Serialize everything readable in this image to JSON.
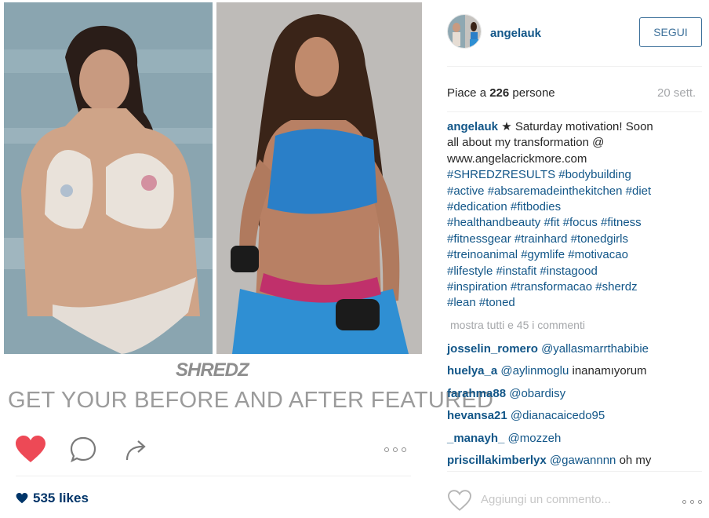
{
  "post": {
    "brand_logo": "SHREDZ",
    "banner": "GET YOUR BEFORE AND AFTER FEATURED",
    "likes": "535 likes"
  },
  "sidebar": {
    "username": "angelauk",
    "follow_label": "SEGUI",
    "likes_prefix": "Piace a",
    "likes_count": "226",
    "likes_suffix": "persone",
    "date": "20 sett.",
    "caption": {
      "user": "angelauk",
      "lines": [
        "★ Saturday motivation! Soon",
        "all about my transformation @",
        "www.angelacrickmore.com",
        "#SHREDZRESULTS #bodybuilding",
        "#active #absaremadeinthekitchen #diet",
        "#dedication #fitbodies",
        "#healthandbeauty #fit #focus #fitness",
        "#fitnessgear #trainhard #tonedgirls",
        "#treinoanimal #gymlife #motivacao",
        "#lifestyle #instafit #instagood",
        "#inspiration #transformacao #sherdz",
        "#lean #toned"
      ]
    },
    "show_all_comments": "mostra tutti e 45 i commenti",
    "comments": [
      {
        "user": "josselin_romero",
        "mention": "@yallasmarrthabibie",
        "text": ""
      },
      {
        "user": "huelya_a",
        "mention": "@aylinmoglu",
        "text": "inanamıyorum"
      },
      {
        "user": "farahma88",
        "mention": "@obardisy",
        "text": ""
      },
      {
        "user": "hevansa21",
        "mention": "@dianacaicedo95",
        "text": ""
      },
      {
        "user": "_manayh_",
        "mention": "@mozzeh",
        "text": ""
      },
      {
        "user": "priscillakimberlyx",
        "mention": "@gawannnn",
        "text": "oh my"
      }
    ],
    "comment_placeholder": "Aggiungi un commento..."
  },
  "colors": {
    "accent": "#125688",
    "like_red": "#ed4956",
    "button_blue": "#3f729b",
    "muted": "#a5a7aa"
  },
  "icons": [
    "heart-filled-icon",
    "comment-bubble-icon",
    "share-arrow-icon",
    "more-options-icon",
    "small-heart-icon",
    "heart-outline-icon"
  ]
}
